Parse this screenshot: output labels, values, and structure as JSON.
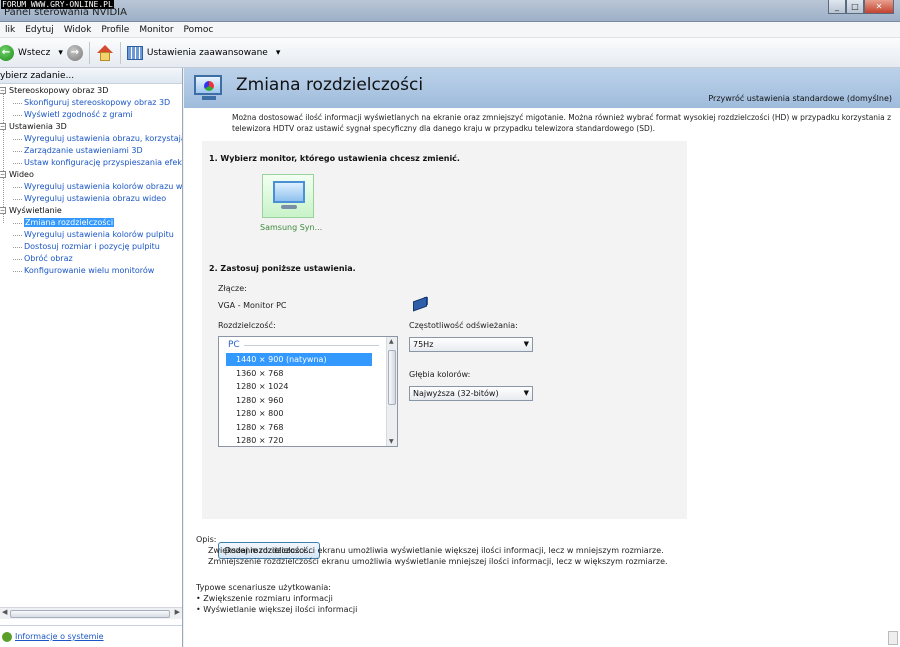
{
  "window": {
    "watermark": "FORUM WWW.GRY-ONLINE.PL",
    "title": "Panel sterowania NVIDIA",
    "controls": [
      "_",
      "□",
      "✕"
    ]
  },
  "menu": {
    "items": [
      "lik",
      "Edytuj",
      "Widok",
      "Profile",
      "Monitor",
      "Pomoc"
    ]
  },
  "toolbar": {
    "back_label": "Wstecz",
    "advanced_label": "Ustawienia zaawansowane"
  },
  "sidebar": {
    "header": "ybierz zadanie...",
    "categories": [
      {
        "label": "Stereoskopowy obraz 3D",
        "items": [
          "Skonfiguruj stereoskopowy obraz 3D",
          "Wyświetl zgodność z grami"
        ]
      },
      {
        "label": "Ustawienia 3D",
        "items": [
          "Wyreguluj ustawienia obrazu, korzystając",
          "Zarządzanie ustawieniami 3D",
          "Ustaw konfigurację przyspieszania efektów"
        ]
      },
      {
        "label": "Wideo",
        "items": [
          "Wyreguluj ustawienia kolorów obrazu wide",
          "Wyreguluj ustawienia obrazu wideo"
        ]
      },
      {
        "label": "Wyświetlanie",
        "items": [
          "Zmiana rozdzielczości",
          "Wyreguluj ustawienia kolorów pulpitu",
          "Dostosuj rozmiar i pozycję pulpitu",
          "Obróć obraz",
          "Konfigurowanie wielu monitorów"
        ]
      }
    ],
    "selected": "Zmiana rozdzielczości",
    "system_info": "Informacje o systemie"
  },
  "main": {
    "title": "Zmiana rozdzielczości",
    "restore": "Przywróć ustawienia standardowe (domyślne)",
    "description": "Można dostosować ilość informacji wyświetlanych na ekranie oraz zmniejszyć migotanie. Można również wybrać format wysokiej rozdzielczości (HD) w przypadku korzystania z telewizora HDTV oraz ustawić sygnał specyficzny dla danego kraju w przypadku telewizora standardowego (SD).",
    "step1": "1. Wybierz monitor, którego ustawienia chcesz zmienić.",
    "monitor_label": "Samsung Syn...",
    "step2": "2. Zastosuj poniższe ustawienia.",
    "connector_label": "Złącze:",
    "connector_value": "VGA - Monitor PC",
    "resolution_label": "Rozdzielczość:",
    "resolution_group": "PC",
    "resolutions": [
      "1440 × 900 (natywna)",
      "1360 × 768",
      "1280 × 1024",
      "1280 × 960",
      "1280 × 800",
      "1280 × 768",
      "1280 × 720"
    ],
    "selected_resolution": "1440 × 900 (natywna)",
    "refresh_label": "Częstotliwość odświeżania:",
    "refresh_value": "75Hz",
    "depth_label": "Głębia kolorów:",
    "depth_value": "Najwyższa (32-bitów)",
    "add_button": "Dodaj rozdzielczości...",
    "opis_label": "Opis:",
    "opis_lines": [
      "Zwiększenie rozdzielczości ekranu umożliwia wyświetlanie większej ilości informacji, lecz w mniejszym rozmiarze.",
      "Zmniejszenie rozdzielczości ekranu umożliwia wyświetlanie mniejszej ilości informacji, lecz w większym rozmiarze."
    ],
    "scen_label": "Typowe scenariusze użytkowania:",
    "scen_items": [
      "• Zwiększenie rozmiaru informacji",
      "• Wyświetlanie większej ilości informacji"
    ]
  }
}
